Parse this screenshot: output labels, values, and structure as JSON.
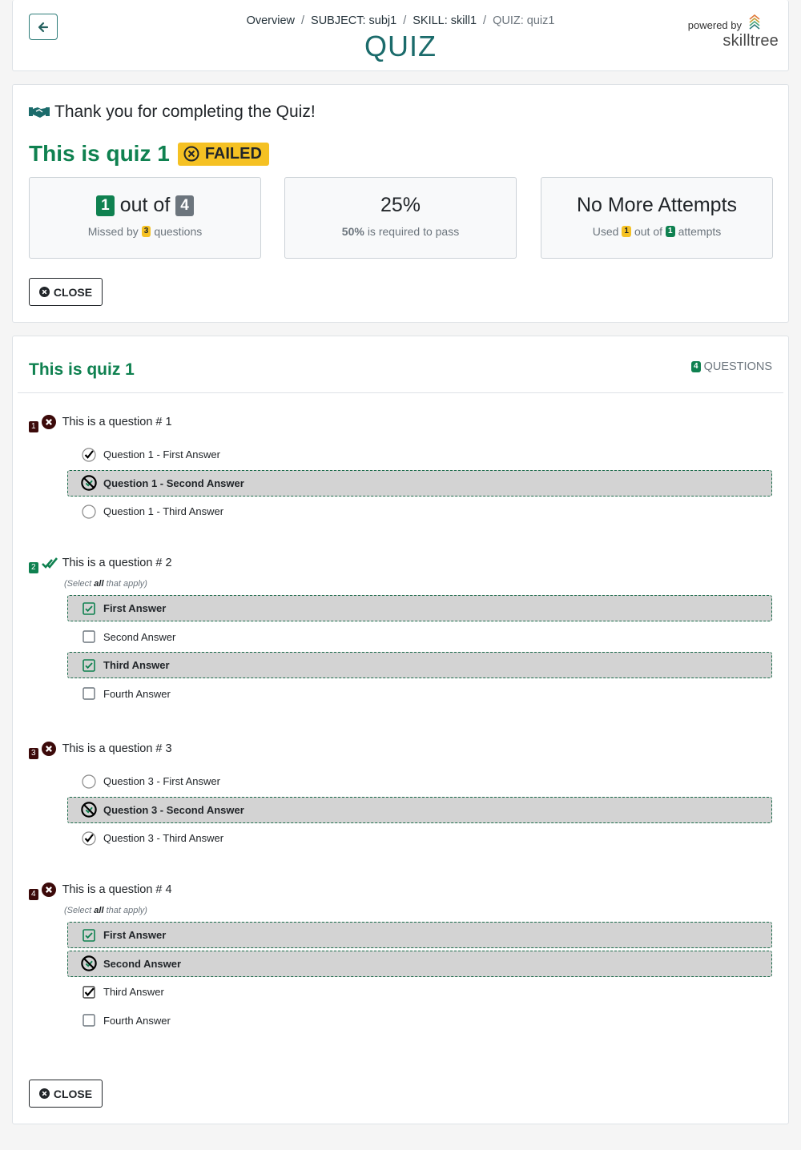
{
  "header": {
    "breadcrumb": {
      "overview": "Overview",
      "subject": "SUBJECT: subj1",
      "skill": "SKILL: skill1",
      "current": "QUIZ: quiz1",
      "separator": "/"
    },
    "title": "QUIZ",
    "powered_by": "powered by",
    "logo_text": "skilltree"
  },
  "summary": {
    "thanks": "Thank you for completing the Quiz!",
    "quiz_name": "This is quiz 1",
    "status": "FAILED",
    "score": {
      "correct": "1",
      "out_of": "out of",
      "total": "4",
      "missed_prefix": "Missed by",
      "missed": "3",
      "missed_suffix": "questions"
    },
    "percent": {
      "value": "25%",
      "required": "50%",
      "required_suffix": "is required to pass"
    },
    "attempts": {
      "title": "No More Attempts",
      "used_prefix": "Used",
      "used": "1",
      "out_of": "out of",
      "max": "1",
      "suffix": "attempts"
    },
    "close_label": "CLOSE"
  },
  "questions_section": {
    "title": "This is quiz 1",
    "count": "4",
    "count_label": "QUESTIONS",
    "close_label": "CLOSE",
    "select_all_hint": {
      "pre": "(Select ",
      "bold": "all",
      "post": " that apply)"
    },
    "items": [
      {
        "num": "1",
        "status": "incorrect",
        "text": "This is a question # 1",
        "multi": false,
        "answers": [
          {
            "text": "Question 1 - First Answer",
            "state": "selected"
          },
          {
            "text": "Question 1 - Second Answer",
            "state": "missed-correct"
          },
          {
            "text": "Question 1 - Third Answer",
            "state": "empty"
          }
        ]
      },
      {
        "num": "2",
        "status": "correct",
        "text": "This is a question # 2",
        "multi": true,
        "answers": [
          {
            "text": "First Answer",
            "state": "correct-selected"
          },
          {
            "text": "Second Answer",
            "state": "empty"
          },
          {
            "text": "Third Answer",
            "state": "correct-selected"
          },
          {
            "text": "Fourth Answer",
            "state": "empty"
          }
        ]
      },
      {
        "num": "3",
        "status": "incorrect",
        "text": "This is a question # 3",
        "multi": false,
        "answers": [
          {
            "text": "Question 3 - First Answer",
            "state": "empty"
          },
          {
            "text": "Question 3 - Second Answer",
            "state": "missed-correct"
          },
          {
            "text": "Question 3 - Third Answer",
            "state": "selected"
          }
        ]
      },
      {
        "num": "4",
        "status": "incorrect",
        "text": "This is a question # 4",
        "multi": true,
        "answers": [
          {
            "text": "First Answer",
            "state": "correct-selected"
          },
          {
            "text": "Second Answer",
            "state": "missed-correct"
          },
          {
            "text": "Third Answer",
            "state": "selected"
          },
          {
            "text": "Fourth Answer",
            "state": "empty"
          }
        ]
      }
    ]
  },
  "colors": {
    "brand_green": "#0f8150",
    "title_teal": "#1b6b6b",
    "failed_yellow": "#f5c123",
    "wrong_dark": "#3c0a0a",
    "grey_badge": "#6c757d"
  }
}
